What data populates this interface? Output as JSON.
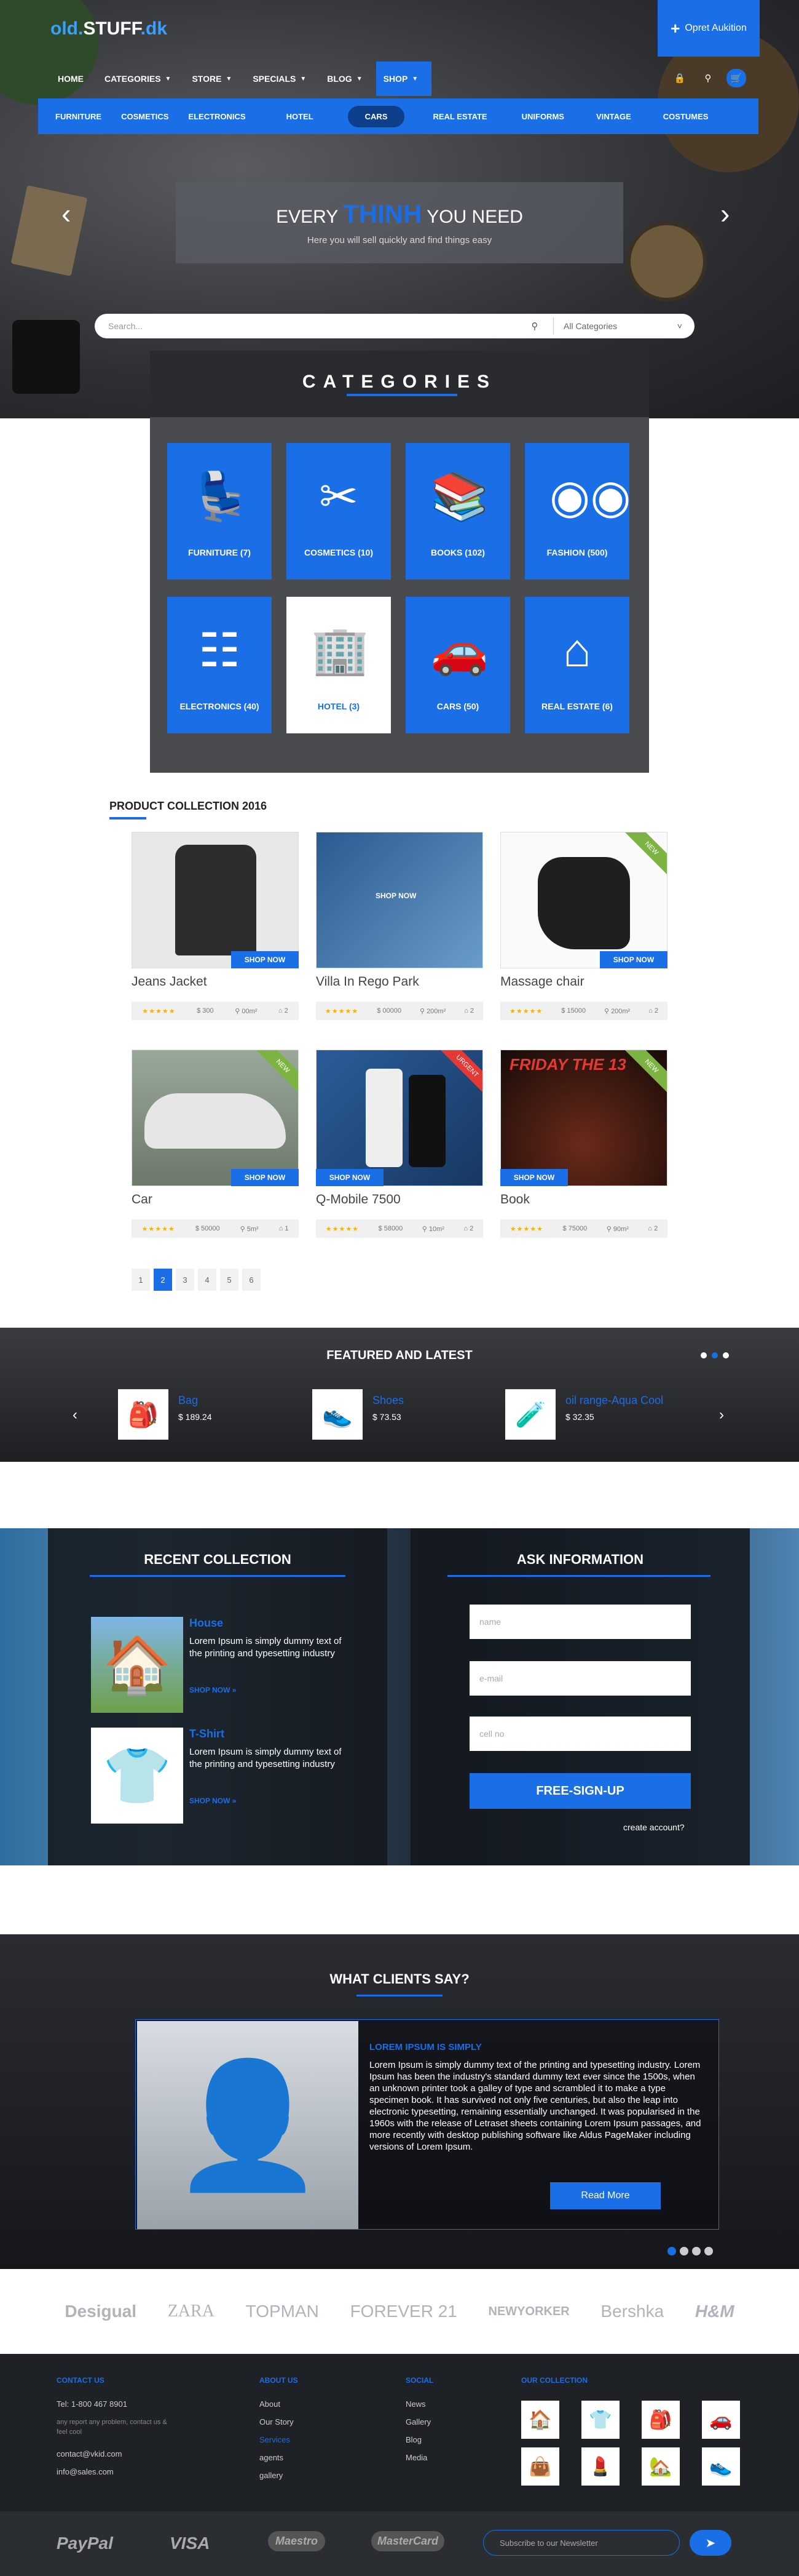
{
  "header": {
    "logo_prefix": "old.",
    "logo_main": "STUFF",
    "logo_suffix": ".dk",
    "cta": "Opret Aukition",
    "nav": [
      "HOME",
      "CATEGORIES",
      "STORE",
      "SPECIALS",
      "BLOG",
      "SHOP"
    ],
    "subnav": [
      "FURNITURE",
      "COSMETICS",
      "ELECTRONICS",
      "HOTEL",
      "CARS",
      "REAL ESTATE",
      "UNIFORMS",
      "VINTAGE",
      "COSTUMES"
    ]
  },
  "hero": {
    "title_a": "EVERY",
    "title_b": "THINH",
    "title_c": "YOU NEED",
    "subtitle": "Here you will sell quickly and find things easy",
    "search_placeholder": "Search...",
    "category_select": "All Categories"
  },
  "categories": {
    "title": "CATEGORIES",
    "items": [
      {
        "label": "FURNITURE (7)",
        "icon": "armchair-icon"
      },
      {
        "label": "COSMETICS (10)",
        "icon": "scissors-icon"
      },
      {
        "label": "BOOKS (102)",
        "icon": "bookshelf-icon"
      },
      {
        "label": "FASHION (500)",
        "icon": "glasses-icon"
      },
      {
        "label": "ELECTRONICS (40)",
        "icon": "remote-icon"
      },
      {
        "label": "HOTEL (3)",
        "icon": "building-icon"
      },
      {
        "label": "CARS (50)",
        "icon": "car-icon"
      },
      {
        "label": "REAL ESTATE (6)",
        "icon": "house-icon"
      }
    ]
  },
  "products": {
    "title": "PRODUCT COLLECTION 2016",
    "shop_label": "SHOP NOW",
    "items": [
      {
        "name": "Jeans Jacket",
        "price": "300",
        "area": "00m²",
        "rooms": "2",
        "ribbon": ""
      },
      {
        "name": "Villa In Rego Park",
        "price": "00000",
        "area": "200m²",
        "rooms": "2",
        "ribbon": ""
      },
      {
        "name": "Massage chair",
        "price": "15000",
        "area": "200m²",
        "rooms": "2",
        "ribbon": "NEW"
      },
      {
        "name": "Car",
        "price": "50000",
        "area": "5m²",
        "rooms": "1",
        "ribbon": "NEW"
      },
      {
        "name": "Q-Mobile 7500",
        "price": "58000",
        "area": "10m²",
        "rooms": "2",
        "ribbon": "URGENT"
      },
      {
        "name": "Book",
        "price": "75000",
        "area": "90m²",
        "rooms": "2",
        "ribbon": "NEW"
      }
    ],
    "pages": [
      "1",
      "2",
      "3",
      "4",
      "5",
      "6"
    ]
  },
  "featured": {
    "title": "FEATURED AND LATEST",
    "items": [
      {
        "name": "Bag",
        "price": "$ 189.24"
      },
      {
        "name": "Shoes",
        "price": "$ 73.53"
      },
      {
        "name": "oil range-Aqua Cool",
        "price": "$ 32.35"
      }
    ]
  },
  "recent": {
    "title": "RECENT  COLLECTION",
    "more": "SHOP NOW",
    "items": [
      {
        "name": "House",
        "desc": "Lorem Ipsum is simply dummy text of the printing and typesetting industry"
      },
      {
        "name": "T-Shirt",
        "desc": "Lorem Ipsum is simply dummy text of the printing and typesetting industry"
      }
    ]
  },
  "ask": {
    "title": "ASK INFORMATION",
    "name": "name",
    "email": "e-mail",
    "phone": "cell no",
    "button": "FREE-SIGN-UP",
    "create": "create account?"
  },
  "testimonial": {
    "title": "WHAT CLIENTS SAY?",
    "heading": "LOREM IPSUM IS SIMPLY",
    "text": "Lorem Ipsum is simply dummy text of the printing and typesetting industry. Lorem Ipsum has been the industry's standard dummy text ever since the 1500s, when an unknown printer took a galley of type and scrambled it to make a type specimen book. It has survived not only five centuries, but also the leap into electronic typesetting, remaining essentially unchanged. It was popularised in the 1960s with the release of Letraset sheets containing Lorem Ipsum passages, and more recently with desktop publishing software like Aldus PageMaker including versions of Lorem Ipsum.",
    "button": "Read More"
  },
  "brands": [
    "Desigual",
    "ZARA",
    "TOPMAN",
    "FOREVER 21",
    "NEWYORKER",
    "Bershka",
    "H&M"
  ],
  "footer": {
    "contact_h": "CONTACT US",
    "tel": "Tel: 1-800 467 8901",
    "note": "any report any problem, contact us & feel cool",
    "mail1": "contact@vkid.com",
    "mail2": "info@sales.com",
    "about_h": "ABOUT US",
    "about": [
      "About",
      "Our Story",
      "Services",
      "agents",
      "gallery"
    ],
    "social_h": "SOCIAL",
    "social": [
      "News",
      "Gallery",
      "Blog",
      "Media"
    ],
    "collection_h": "OUR COLLECTION"
  },
  "payments": [
    "PayPal",
    "VISA",
    "Maestro",
    "MasterCard"
  ],
  "newsletter": "Subscribe to our Newsletter"
}
